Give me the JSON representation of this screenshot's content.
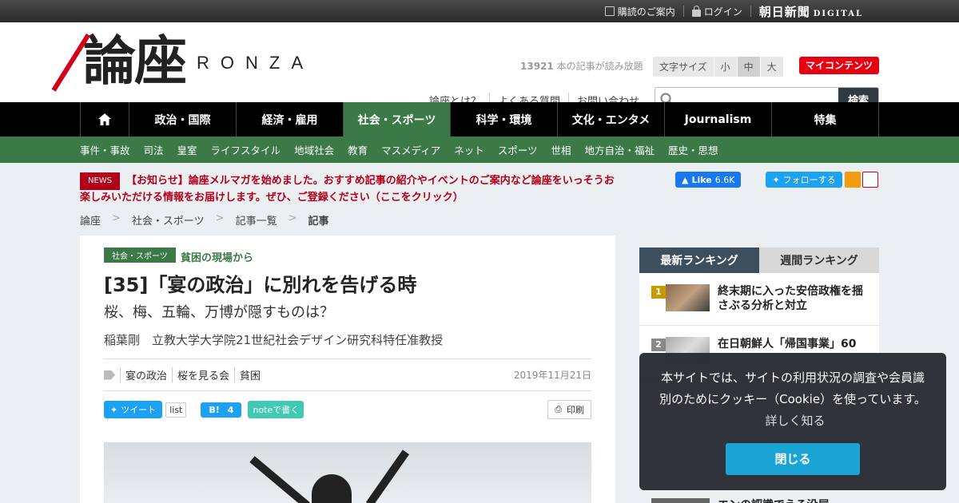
{
  "topbar": {
    "items": [
      {
        "icon": "edit-icon",
        "label": "購読のご案内"
      },
      {
        "icon": "lock-icon",
        "label": "ログイン"
      }
    ],
    "brand": "朝日新聞",
    "brand_sub": "DIGITAL"
  },
  "header": {
    "logo_kanji": "論座",
    "logo_roman": "RONZA",
    "read_count": "13921",
    "read_count_suffix": " 本の記事が読み放題",
    "font_size_label": "文字サイズ",
    "font_sizes": [
      "小",
      "中",
      "大"
    ],
    "font_size_selected": "中",
    "my_contents": "マイコンテンツ",
    "help_links": [
      "論座とは？",
      "よくある質問",
      "お問い合わせ"
    ],
    "search_placeholder": "",
    "search_button": "検索"
  },
  "main_nav": [
    "政治・国際",
    "経済・雇用",
    "社会・スポーツ",
    "科学・環境",
    "文化・エンタメ",
    "Journalism",
    "特集"
  ],
  "main_nav_active": "社会・スポーツ",
  "sub_nav": [
    "事件・事故",
    "司法",
    "皇室",
    "ライフスタイル",
    "地域社会",
    "教育",
    "マスメディア",
    "ネット",
    "スポーツ",
    "世相",
    "地方自治・福祉",
    "歴史・思想"
  ],
  "notice": {
    "badge": "NEWS",
    "text": "【お知らせ】論座メルマガを始めました。おすすめ記事の紹介やイベントのご案内など論座をいっそうお楽しみいただける情報をお届けします。ぜひ、ご登録ください（ここをクリック）"
  },
  "social": {
    "fb_label": "Like",
    "fb_count": "6.6K",
    "twitter_follow": "フォローする"
  },
  "breadcrumb": [
    "論座",
    "社会・スポーツ",
    "記事一覧",
    "記事"
  ],
  "article": {
    "category": "社会・スポーツ",
    "series": "貧困の現場から",
    "title": "[35]「宴の政治」に別れを告げる時",
    "subtitle": "桜、梅、五輪、万博が隠すものは？",
    "author": "稲葉剛　立教大学大学院21世紀社会デザイン研究科特任准教授",
    "tags": [
      "宴の政治",
      "桜を見る会",
      "貧困"
    ],
    "date": "2019年11月21日",
    "share": {
      "tweet": "ツイート",
      "list": "list",
      "hatena_count": "4",
      "hatena_label": "B!",
      "note": "noteで書く",
      "print": "印刷"
    }
  },
  "ranking": {
    "tabs": [
      "最新ランキング",
      "週間ランキング"
    ],
    "active_tab": "最新ランキング",
    "items": [
      {
        "rank": "1",
        "title": "終末期に入った安倍政権を揺さぶる分析と対立"
      },
      {
        "rank": "2",
        "title": "在日朝鮮人「帰国事業」60"
      }
    ],
    "peek_title": "エンの認識でえる没屋ー"
  },
  "cookie": {
    "text": "本サイトでは、サイトの利用状況の調査や会員識別のためにクッキー（Cookie）を使っています。",
    "link": "詳しく知る",
    "button": "閉じる"
  }
}
